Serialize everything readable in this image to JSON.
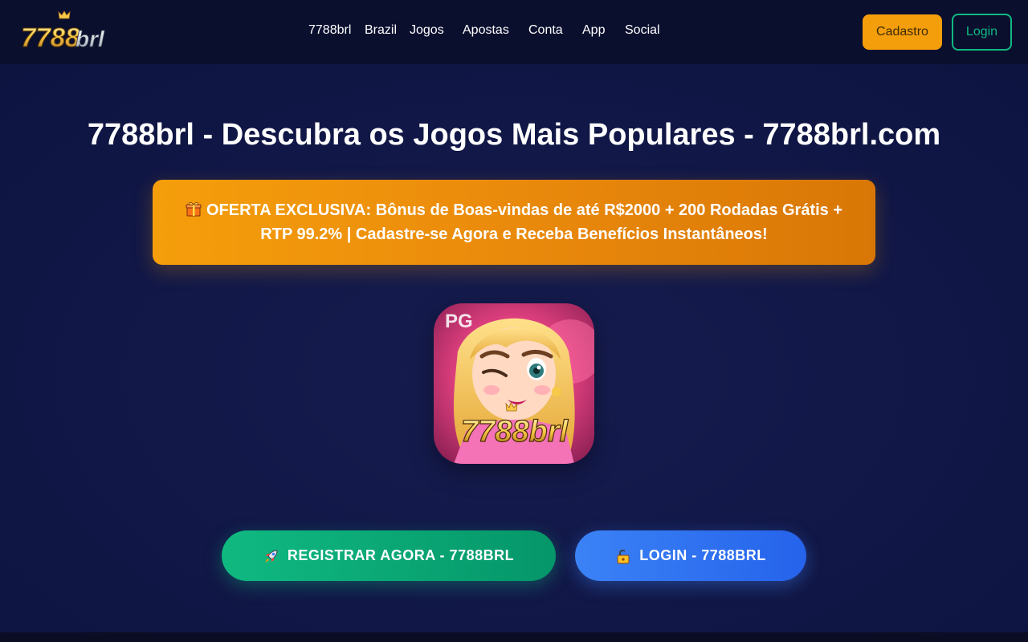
{
  "header": {
    "logo_text": "7788brl",
    "nav": [
      "7788brl",
      "Brazil",
      "Jogos",
      "Apostas",
      "Conta",
      "App",
      "Social"
    ],
    "signup_label": "Cadastro",
    "login_label": "Login"
  },
  "main": {
    "title": "7788brl - Descubra os Jogos Mais Populares - 7788brl.com",
    "offer_text": "OFERTA EXCLUSIVA: Bônus de Boas-vindas de até R$2000 + 200 Rodadas Grátis + RTP 99.2% | Cadastre-se Agora e Receba Benefícios Instantâneos!",
    "offer_icon": "gift-icon",
    "app_icon": {
      "badge": "PG",
      "brand": "7788brl"
    },
    "register_cta": "REGISTRAR AGORA - 7788BRL",
    "register_icon": "rocket-icon",
    "login_cta": "LOGIN - 7788BRL",
    "login_icon": "lock-icon"
  },
  "colors": {
    "header_bg": "#0b0f2e",
    "page_bg": "#121848",
    "accent_orange": "#f59e0b",
    "accent_green": "#10b981",
    "accent_blue": "#3b82f6"
  }
}
